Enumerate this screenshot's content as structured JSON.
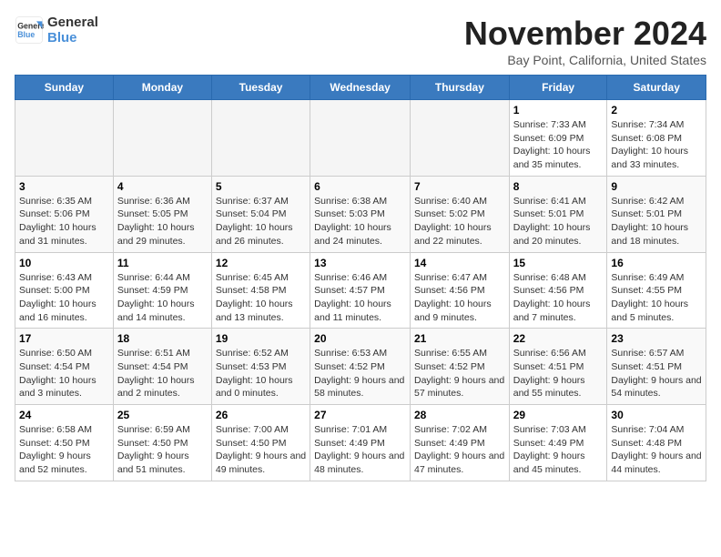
{
  "logo": {
    "line1": "General",
    "line2": "Blue"
  },
  "title": "November 2024",
  "location": "Bay Point, California, United States",
  "weekdays": [
    "Sunday",
    "Monday",
    "Tuesday",
    "Wednesday",
    "Thursday",
    "Friday",
    "Saturday"
  ],
  "weeks": [
    [
      {
        "day": "",
        "info": ""
      },
      {
        "day": "",
        "info": ""
      },
      {
        "day": "",
        "info": ""
      },
      {
        "day": "",
        "info": ""
      },
      {
        "day": "",
        "info": ""
      },
      {
        "day": "1",
        "info": "Sunrise: 7:33 AM\nSunset: 6:09 PM\nDaylight: 10 hours and 35 minutes."
      },
      {
        "day": "2",
        "info": "Sunrise: 7:34 AM\nSunset: 6:08 PM\nDaylight: 10 hours and 33 minutes."
      }
    ],
    [
      {
        "day": "3",
        "info": "Sunrise: 6:35 AM\nSunset: 5:06 PM\nDaylight: 10 hours and 31 minutes."
      },
      {
        "day": "4",
        "info": "Sunrise: 6:36 AM\nSunset: 5:05 PM\nDaylight: 10 hours and 29 minutes."
      },
      {
        "day": "5",
        "info": "Sunrise: 6:37 AM\nSunset: 5:04 PM\nDaylight: 10 hours and 26 minutes."
      },
      {
        "day": "6",
        "info": "Sunrise: 6:38 AM\nSunset: 5:03 PM\nDaylight: 10 hours and 24 minutes."
      },
      {
        "day": "7",
        "info": "Sunrise: 6:40 AM\nSunset: 5:02 PM\nDaylight: 10 hours and 22 minutes."
      },
      {
        "day": "8",
        "info": "Sunrise: 6:41 AM\nSunset: 5:01 PM\nDaylight: 10 hours and 20 minutes."
      },
      {
        "day": "9",
        "info": "Sunrise: 6:42 AM\nSunset: 5:01 PM\nDaylight: 10 hours and 18 minutes."
      }
    ],
    [
      {
        "day": "10",
        "info": "Sunrise: 6:43 AM\nSunset: 5:00 PM\nDaylight: 10 hours and 16 minutes."
      },
      {
        "day": "11",
        "info": "Sunrise: 6:44 AM\nSunset: 4:59 PM\nDaylight: 10 hours and 14 minutes."
      },
      {
        "day": "12",
        "info": "Sunrise: 6:45 AM\nSunset: 4:58 PM\nDaylight: 10 hours and 13 minutes."
      },
      {
        "day": "13",
        "info": "Sunrise: 6:46 AM\nSunset: 4:57 PM\nDaylight: 10 hours and 11 minutes."
      },
      {
        "day": "14",
        "info": "Sunrise: 6:47 AM\nSunset: 4:56 PM\nDaylight: 10 hours and 9 minutes."
      },
      {
        "day": "15",
        "info": "Sunrise: 6:48 AM\nSunset: 4:56 PM\nDaylight: 10 hours and 7 minutes."
      },
      {
        "day": "16",
        "info": "Sunrise: 6:49 AM\nSunset: 4:55 PM\nDaylight: 10 hours and 5 minutes."
      }
    ],
    [
      {
        "day": "17",
        "info": "Sunrise: 6:50 AM\nSunset: 4:54 PM\nDaylight: 10 hours and 3 minutes."
      },
      {
        "day": "18",
        "info": "Sunrise: 6:51 AM\nSunset: 4:54 PM\nDaylight: 10 hours and 2 minutes."
      },
      {
        "day": "19",
        "info": "Sunrise: 6:52 AM\nSunset: 4:53 PM\nDaylight: 10 hours and 0 minutes."
      },
      {
        "day": "20",
        "info": "Sunrise: 6:53 AM\nSunset: 4:52 PM\nDaylight: 9 hours and 58 minutes."
      },
      {
        "day": "21",
        "info": "Sunrise: 6:55 AM\nSunset: 4:52 PM\nDaylight: 9 hours and 57 minutes."
      },
      {
        "day": "22",
        "info": "Sunrise: 6:56 AM\nSunset: 4:51 PM\nDaylight: 9 hours and 55 minutes."
      },
      {
        "day": "23",
        "info": "Sunrise: 6:57 AM\nSunset: 4:51 PM\nDaylight: 9 hours and 54 minutes."
      }
    ],
    [
      {
        "day": "24",
        "info": "Sunrise: 6:58 AM\nSunset: 4:50 PM\nDaylight: 9 hours and 52 minutes."
      },
      {
        "day": "25",
        "info": "Sunrise: 6:59 AM\nSunset: 4:50 PM\nDaylight: 9 hours and 51 minutes."
      },
      {
        "day": "26",
        "info": "Sunrise: 7:00 AM\nSunset: 4:50 PM\nDaylight: 9 hours and 49 minutes."
      },
      {
        "day": "27",
        "info": "Sunrise: 7:01 AM\nSunset: 4:49 PM\nDaylight: 9 hours and 48 minutes."
      },
      {
        "day": "28",
        "info": "Sunrise: 7:02 AM\nSunset: 4:49 PM\nDaylight: 9 hours and 47 minutes."
      },
      {
        "day": "29",
        "info": "Sunrise: 7:03 AM\nSunset: 4:49 PM\nDaylight: 9 hours and 45 minutes."
      },
      {
        "day": "30",
        "info": "Sunrise: 7:04 AM\nSunset: 4:48 PM\nDaylight: 9 hours and 44 minutes."
      }
    ]
  ]
}
